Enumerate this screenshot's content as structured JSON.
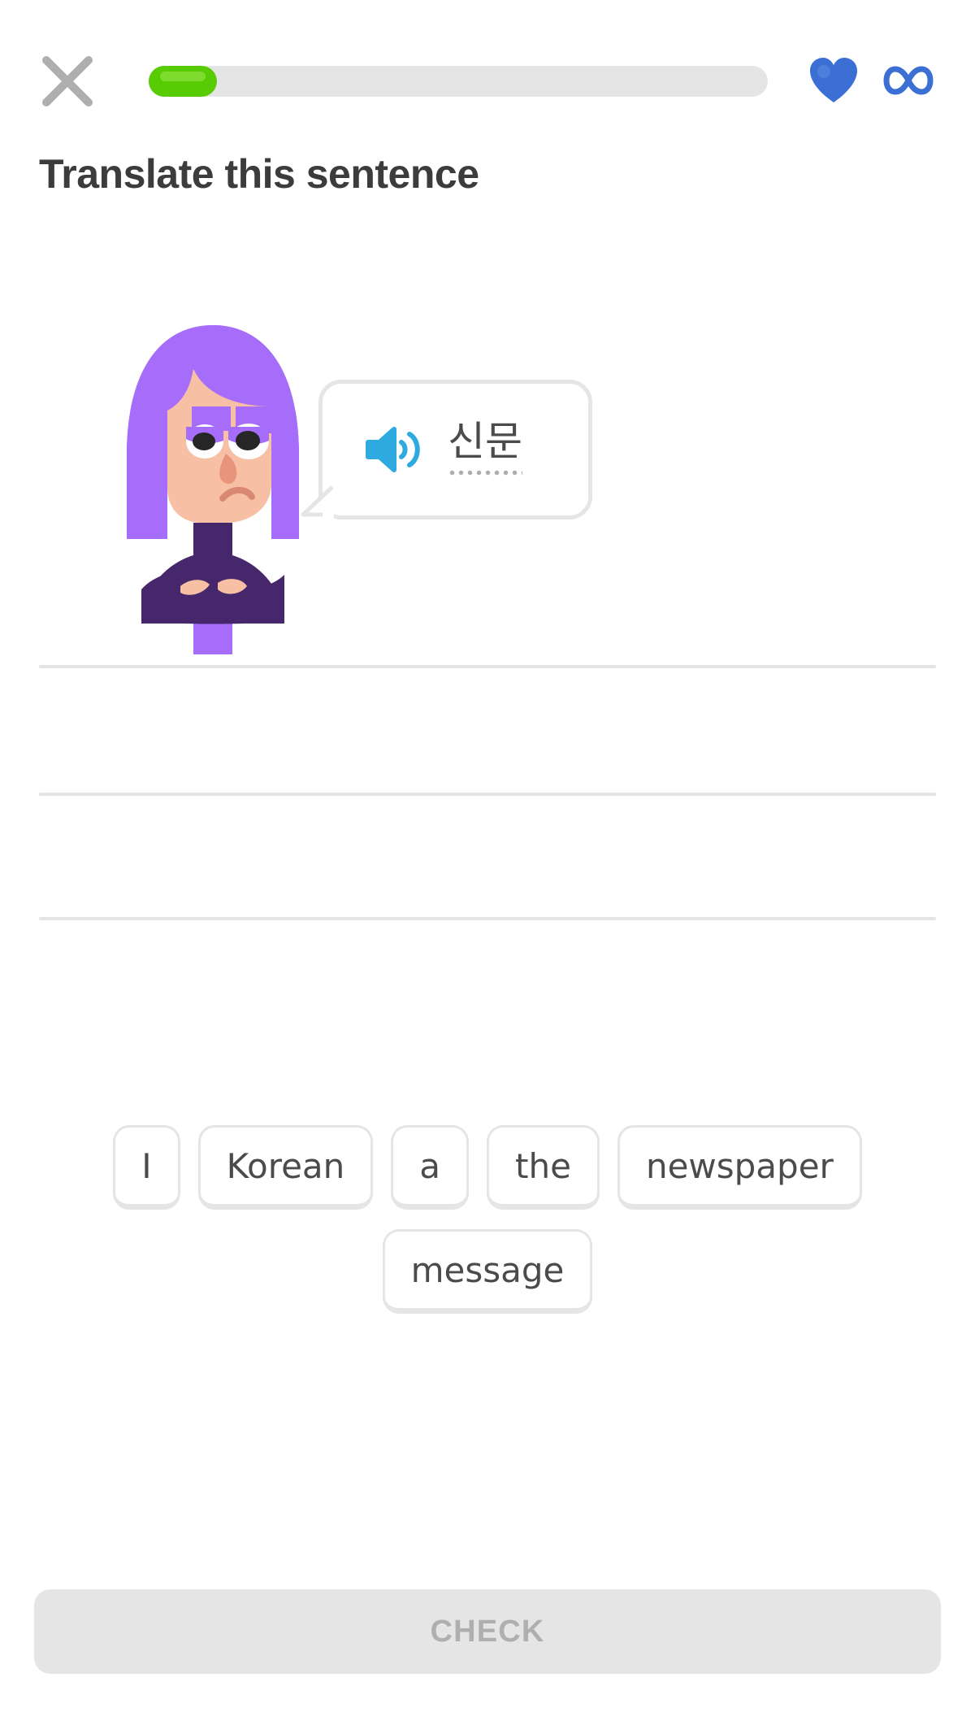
{
  "header": {
    "close_icon": "close-icon",
    "progress": {
      "percent": 11,
      "fill_color": "#58cc02",
      "track_color": "#e5e5e5"
    },
    "hearts_icon": "heart-icon",
    "hearts_value": "∞",
    "infinity_icon": "infinity-icon",
    "accent_color": "#3b6fd4"
  },
  "instruction": {
    "title": "Translate this sentence"
  },
  "prompt": {
    "speaker_icon": "speaker-icon",
    "speaker_color": "#2eaae0",
    "word": "신문",
    "has_dotted_underline": true,
    "character": "lily-character"
  },
  "answer": {
    "lines": [
      "",
      "",
      ""
    ],
    "line_color": "#e5e5e5"
  },
  "word_bank": {
    "rows": [
      [
        {
          "label": "I"
        },
        {
          "label": "Korean"
        },
        {
          "label": "a"
        },
        {
          "label": "the"
        },
        {
          "label": "newspaper"
        }
      ],
      [
        {
          "label": "message"
        }
      ]
    ]
  },
  "footer": {
    "check_label": "CHECK",
    "check_enabled": false
  }
}
